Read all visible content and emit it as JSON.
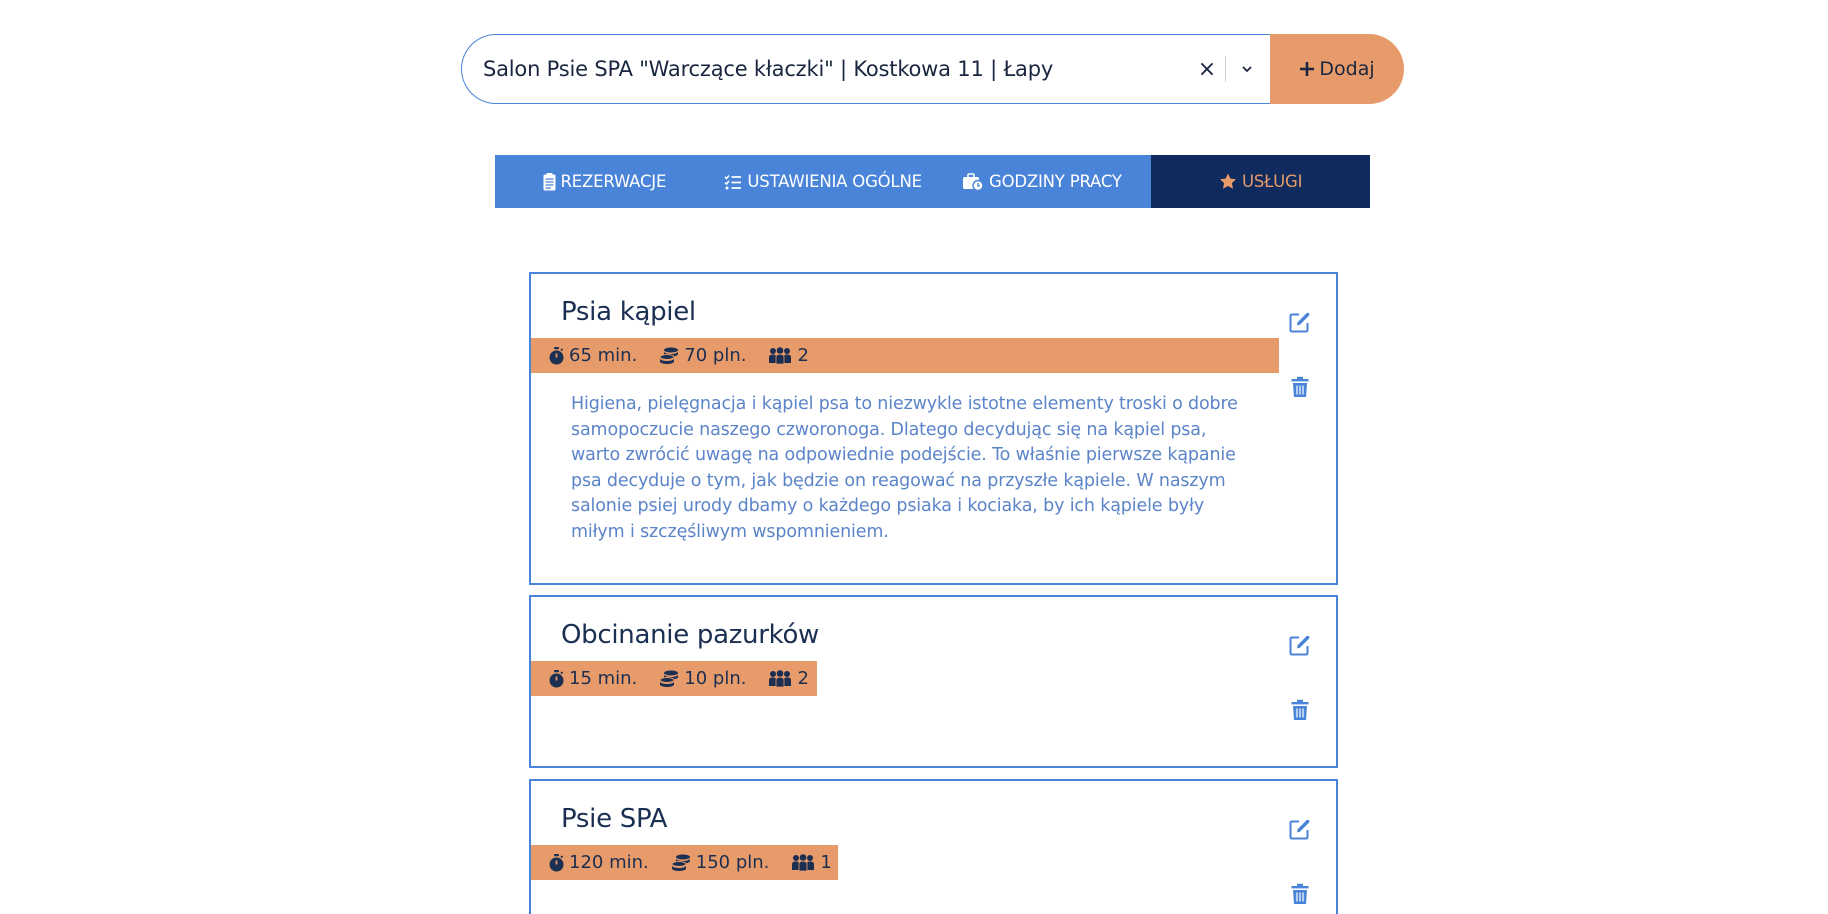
{
  "salon_select": {
    "value": "Salon Psie SPA \"Warczące kłaczki\" | Kostkowa 11 | Łapy",
    "clear_symbol": "×"
  },
  "add_button": {
    "label": "Dodaj",
    "icon": "plus-icon"
  },
  "tabs": [
    {
      "label": "REZERWACJE",
      "icon": "clipboard-list-icon",
      "active": false
    },
    {
      "label": "USTAWIENIA OGÓLNE",
      "icon": "tasks-checklist-icon",
      "active": false
    },
    {
      "label": "GODZINY PRACY",
      "icon": "business-time-icon",
      "active": false
    },
    {
      "label": "USŁUGI",
      "icon": "star-icon",
      "active": true
    }
  ],
  "services": [
    {
      "name": "Psia kąpiel",
      "duration": "65 min.",
      "price": "70 pln.",
      "capacity": "2",
      "description": "Higiena, pielęgnacja i kąpiel psa to niezwykle istotne elementy troski o dobre samopoczucie naszego czworonoga. Dlatego decydując się na kąpiel psa, warto zwrócić uwagę na odpowiednie podejście. To właśnie pierwsze kąpanie psa decyduje o tym, jak będzie on reagować na przyszłe kąpiele. W naszym salonie psiej urody dbamy o każdego psiaka i kociaka, by ich kąpiele były miłym i szczęśliwym wspomnieniem."
    },
    {
      "name": "Obcinanie pazurków",
      "duration": "15 min.",
      "price": "10 pln.",
      "capacity": "2",
      "description": ""
    },
    {
      "name": "Psie SPA",
      "duration": "120 min.",
      "price": "150 pln.",
      "capacity": "1",
      "description": ""
    }
  ],
  "colors": {
    "primary_blue": "#4a84d8",
    "navy": "#0f2a5c",
    "accent_orange": "#e89b6a",
    "description_text": "#5b84c9"
  }
}
